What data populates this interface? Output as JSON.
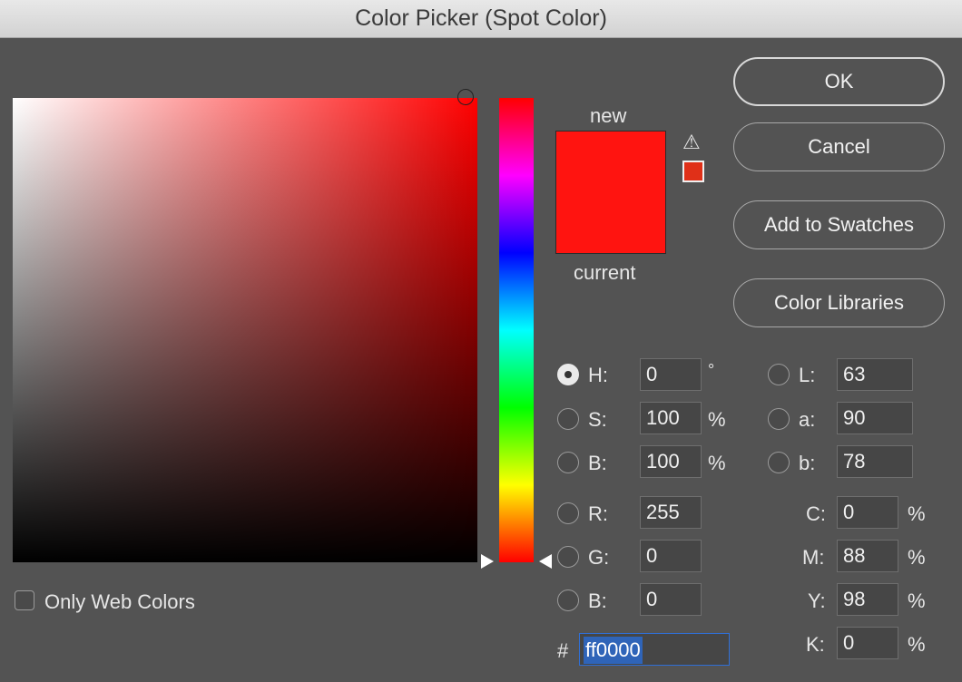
{
  "window": {
    "title": "Color Picker (Spot Color)"
  },
  "preview": {
    "new_label": "new",
    "current_label": "current",
    "new_color": "#ff1410",
    "current_color": "#ff1410",
    "gamut_color": "#e03018",
    "warning_icon": "⚠"
  },
  "buttons": {
    "ok": "OK",
    "cancel": "Cancel",
    "add_to_swatches": "Add to Swatches",
    "color_libraries": "Color Libraries"
  },
  "hsb": {
    "h": {
      "label": "H:",
      "value": "0",
      "unit": "°"
    },
    "s": {
      "label": "S:",
      "value": "100",
      "unit": "%"
    },
    "b": {
      "label": "B:",
      "value": "100",
      "unit": "%"
    }
  },
  "rgb": {
    "r": {
      "label": "R:",
      "value": "255"
    },
    "g": {
      "label": "G:",
      "value": "0"
    },
    "b": {
      "label": "B:",
      "value": "0"
    }
  },
  "lab": {
    "l": {
      "label": "L:",
      "value": "63"
    },
    "a": {
      "label": "a:",
      "value": "90"
    },
    "b": {
      "label": "b:",
      "value": "78"
    }
  },
  "cmyk": {
    "c": {
      "label": "C:",
      "value": "0",
      "unit": "%"
    },
    "m": {
      "label": "M:",
      "value": "88",
      "unit": "%"
    },
    "y": {
      "label": "Y:",
      "value": "98",
      "unit": "%"
    },
    "k": {
      "label": "K:",
      "value": "0",
      "unit": "%"
    }
  },
  "hex": {
    "label": "#",
    "value": "ff0000"
  },
  "web_colors": {
    "label": "Only Web Colors"
  }
}
